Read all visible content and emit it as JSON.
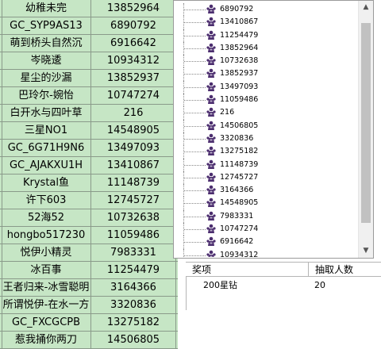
{
  "sheet": {
    "rows": [
      {
        "name": "幼稚未完",
        "value": "13852964"
      },
      {
        "name": "GC_SYP9AS13",
        "value": "6890792"
      },
      {
        "name": "萌到桥头自然沉",
        "value": "6916642"
      },
      {
        "name": "岑晓逶",
        "value": "10934312"
      },
      {
        "name": "星尘的沙漏",
        "value": "13852937"
      },
      {
        "name": "巴玲尔-婉怡",
        "value": "10747274"
      },
      {
        "name": "白开水与四叶草",
        "value": "216"
      },
      {
        "name": "三星NO1",
        "value": "14548905"
      },
      {
        "name": "GC_6G71H9N6",
        "value": "13497093"
      },
      {
        "name": "GC_AJAKXU1H",
        "value": "13410867"
      },
      {
        "name": "Krystal鱼",
        "value": "11148739"
      },
      {
        "name": "许下603",
        "value": "12745727"
      },
      {
        "name": "52海52",
        "value": "10732638"
      },
      {
        "name": "hongbo517230",
        "value": "11059486"
      },
      {
        "name": "悦伊小精灵",
        "value": "7983331"
      },
      {
        "name": "冰百事",
        "value": "11254479"
      },
      {
        "name": "王者归来-冰雪聪明",
        "value": "3164366"
      },
      {
        "name": "所谓悦伊-在水一方",
        "value": "3320836"
      },
      {
        "name": "GC_FXCGCPB",
        "value": "13275182"
      },
      {
        "name": "惹我捅你两刀",
        "value": "14506805"
      }
    ]
  },
  "tree": {
    "items": [
      "6890792",
      "13410867",
      "11254479",
      "13852964",
      "10732638",
      "13852937",
      "13497093",
      "11059486",
      "216",
      "14506805",
      "3320836",
      "13275182",
      "11148739",
      "12745727",
      "3164366",
      "14548905",
      "7983331",
      "10747274",
      "6916642",
      "10934312"
    ],
    "icon": "user-group-icon",
    "scroll_up_glyph": "▲",
    "scroll_down_glyph": "▼"
  },
  "prize_table": {
    "header_prize": "奖项",
    "header_count": "抽取人数",
    "rows": [
      {
        "prize": "200星钻",
        "count": "20"
      }
    ]
  },
  "colors": {
    "selected_row": "#c6e6c5",
    "tree_icon": "#4b2d6e"
  }
}
